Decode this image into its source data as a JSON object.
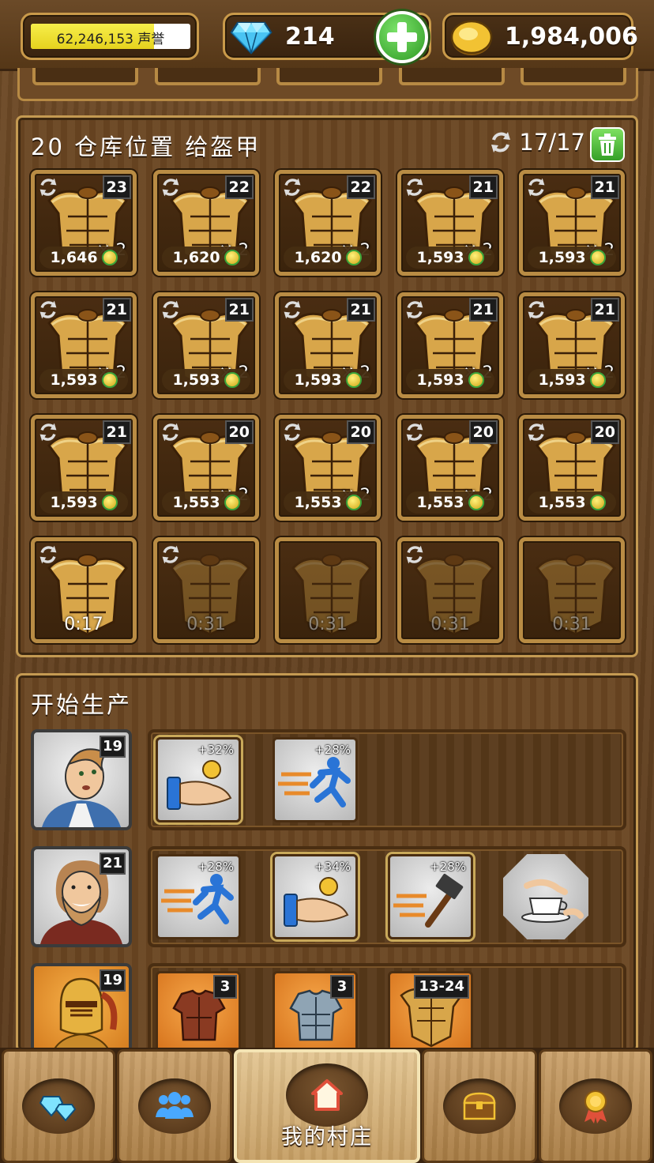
{
  "top_bar": {
    "fame": {
      "value": "62,246,153",
      "label": "声誉",
      "progress": 0.77
    },
    "gems": {
      "value": "214",
      "icon": "diamond-icon"
    },
    "gold": {
      "value": "1,984,006",
      "icon": "gold-coin-icon"
    },
    "add_button_icon": "plus-icon"
  },
  "warehouse": {
    "title": "20 仓库位置 给盔甲",
    "capacity": "17/17",
    "trash_icon": "trash-icon",
    "item_icon": "golden-breastplate-icon",
    "slots": [
      {
        "level": "23",
        "qty": "× 2",
        "price": "1,646"
      },
      {
        "level": "22",
        "qty": "× 2",
        "price": "1,620"
      },
      {
        "level": "22",
        "qty": "× 2",
        "price": "1,620"
      },
      {
        "level": "21",
        "qty": "× 2",
        "price": "1,593"
      },
      {
        "level": "21",
        "qty": "× 2",
        "price": "1,593"
      },
      {
        "level": "21",
        "qty": "× 2",
        "price": "1,593"
      },
      {
        "level": "21",
        "qty": "× 2",
        "price": "1,593"
      },
      {
        "level": "21",
        "qty": "× 2",
        "price": "1,593"
      },
      {
        "level": "21",
        "qty": "× 2",
        "price": "1,593"
      },
      {
        "level": "21",
        "qty": "× 2",
        "price": "1,593"
      },
      {
        "level": "21",
        "qty": "",
        "price": "1,593"
      },
      {
        "level": "20",
        "qty": "× 2",
        "price": "1,553"
      },
      {
        "level": "20",
        "qty": "× 2",
        "price": "1,553"
      },
      {
        "level": "20",
        "qty": "× 2",
        "price": "1,553"
      },
      {
        "level": "20",
        "qty": "",
        "price": "1,553"
      }
    ],
    "pending": [
      {
        "timer": "0:17",
        "refresh": true,
        "active": true
      },
      {
        "timer": "0:31",
        "refresh": true,
        "active": false
      },
      {
        "timer": "0:31",
        "refresh": false,
        "active": false
      },
      {
        "timer": "0:31",
        "refresh": true,
        "active": false
      },
      {
        "timer": "0:31",
        "refresh": false,
        "active": false
      }
    ]
  },
  "production": {
    "title": "开始生产",
    "workers": [
      {
        "level": "19",
        "portrait": "young-man-portrait",
        "skills": [
          {
            "pct": "+32%",
            "icon": "hand-coin-icon"
          },
          {
            "pct": "+28%",
            "icon": "running-speed-icon"
          }
        ]
      },
      {
        "level": "21",
        "portrait": "bearded-man-portrait",
        "skills": [
          {
            "pct": "+28%",
            "icon": "running-speed-icon"
          },
          {
            "pct": "+34%",
            "icon": "hand-coin-icon"
          },
          {
            "pct": "+28%",
            "icon": "hammer-speed-icon"
          },
          {
            "pct": "",
            "icon": "tea-cup-icon"
          }
        ]
      },
      {
        "level": "19",
        "portrait": "golden-knight-portrait",
        "recipes": [
          {
            "level": "3",
            "icon": "leather-armor-icon"
          },
          {
            "level": "3",
            "icon": "steel-armor-icon"
          },
          {
            "level": "13-24",
            "icon": "golden-breastplate-icon"
          }
        ]
      }
    ]
  },
  "nav": {
    "items": [
      {
        "icon": "gems-icon",
        "label": ""
      },
      {
        "icon": "people-icon",
        "label": ""
      },
      {
        "icon": "home-icon",
        "label": "我的村庄",
        "active": true
      },
      {
        "icon": "treasure-chest-icon",
        "label": ""
      },
      {
        "icon": "award-medal-icon",
        "label": ""
      }
    ]
  },
  "colors": {
    "wood_dark": "#5a3a1c",
    "wood_frame": "#b98c44",
    "accent_green": "#35a028",
    "fame_yellow": "#f7ee4a"
  }
}
